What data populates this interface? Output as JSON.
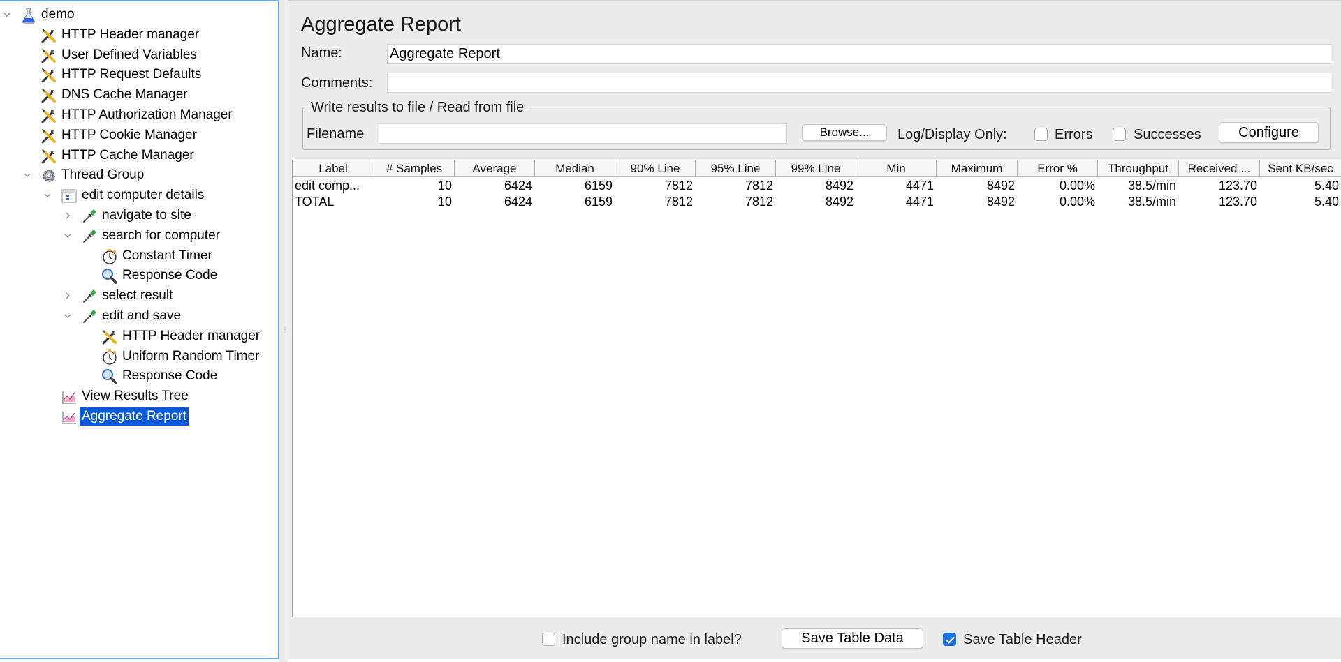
{
  "tree": {
    "items": [
      {
        "label": "demo",
        "icon": "beaker-icon",
        "chevron": "expanded"
      },
      {
        "label": "HTTP Header manager",
        "icon": "wrench-screwdriver-icon"
      },
      {
        "label": "User Defined Variables",
        "icon": "wrench-screwdriver-icon"
      },
      {
        "label": "HTTP Request Defaults",
        "icon": "wrench-screwdriver-icon"
      },
      {
        "label": "DNS Cache Manager",
        "icon": "wrench-screwdriver-icon"
      },
      {
        "label": "HTTP Authorization Manager",
        "icon": "wrench-screwdriver-icon"
      },
      {
        "label": "HTTP Cookie Manager",
        "icon": "wrench-screwdriver-icon"
      },
      {
        "label": "HTTP Cache Manager",
        "icon": "wrench-screwdriver-icon"
      },
      {
        "label": "Thread Group",
        "icon": "gear-icon",
        "chevron": "expanded"
      },
      {
        "label": "edit computer details",
        "icon": "controller-icon",
        "chevron": "expanded"
      },
      {
        "label": "navigate to site",
        "icon": "pipette-icon",
        "chevron": "collapsed"
      },
      {
        "label": "search for computer",
        "icon": "pipette-icon",
        "chevron": "expanded"
      },
      {
        "label": "Constant Timer",
        "icon": "stopwatch-icon"
      },
      {
        "label": "Response Code",
        "icon": "magnifier-icon"
      },
      {
        "label": "select result",
        "icon": "pipette-icon",
        "chevron": "collapsed"
      },
      {
        "label": "edit and save",
        "icon": "pipette-icon",
        "chevron": "expanded"
      },
      {
        "label": "HTTP Header manager",
        "icon": "wrench-screwdriver-icon"
      },
      {
        "label": "Uniform Random Timer",
        "icon": "stopwatch-icon"
      },
      {
        "label": "Response Code",
        "icon": "magnifier-icon"
      },
      {
        "label": "View Results Tree",
        "icon": "graph-icon"
      },
      {
        "label": "Aggregate Report",
        "icon": "graph-icon",
        "selected": true
      }
    ]
  },
  "panel": {
    "title": "Aggregate Report",
    "name_label": "Name:",
    "name_value": "Aggregate Report",
    "comments_label": "Comments:",
    "comments_value": "",
    "file_group_title": "Write results to file / Read from file",
    "filename_label": "Filename",
    "filename_value": "",
    "browse_button": "Browse...",
    "log_display_label": "Log/Display Only:",
    "errors_label": "Errors",
    "errors_checked": false,
    "successes_label": "Successes",
    "successes_checked": false,
    "configure_button": "Configure"
  },
  "table": {
    "columns": [
      "Label",
      "# Samples",
      "Average",
      "Median",
      "90% Line",
      "95% Line",
      "99% Line",
      "Min",
      "Maximum",
      "Error %",
      "Throughput",
      "Received ...",
      "Sent KB/sec"
    ],
    "rows": [
      [
        "edit comp...",
        "10",
        "6424",
        "6159",
        "7812",
        "7812",
        "8492",
        "4471",
        "8492",
        "0.00%",
        "38.5/min",
        "123.70",
        "5.40"
      ],
      [
        "TOTAL",
        "10",
        "6424",
        "6159",
        "7812",
        "7812",
        "8492",
        "4471",
        "8492",
        "0.00%",
        "38.5/min",
        "123.70",
        "5.40"
      ]
    ]
  },
  "footer": {
    "include_group_label": "Include group name in label?",
    "include_group_checked": false,
    "save_table_data_button": "Save Table Data",
    "save_table_header_label": "Save Table Header",
    "save_table_header_checked": true
  },
  "colors": {
    "selection": "#0b5ad9",
    "tree_border": "#6aa8de",
    "panel_background": "#ececec"
  }
}
